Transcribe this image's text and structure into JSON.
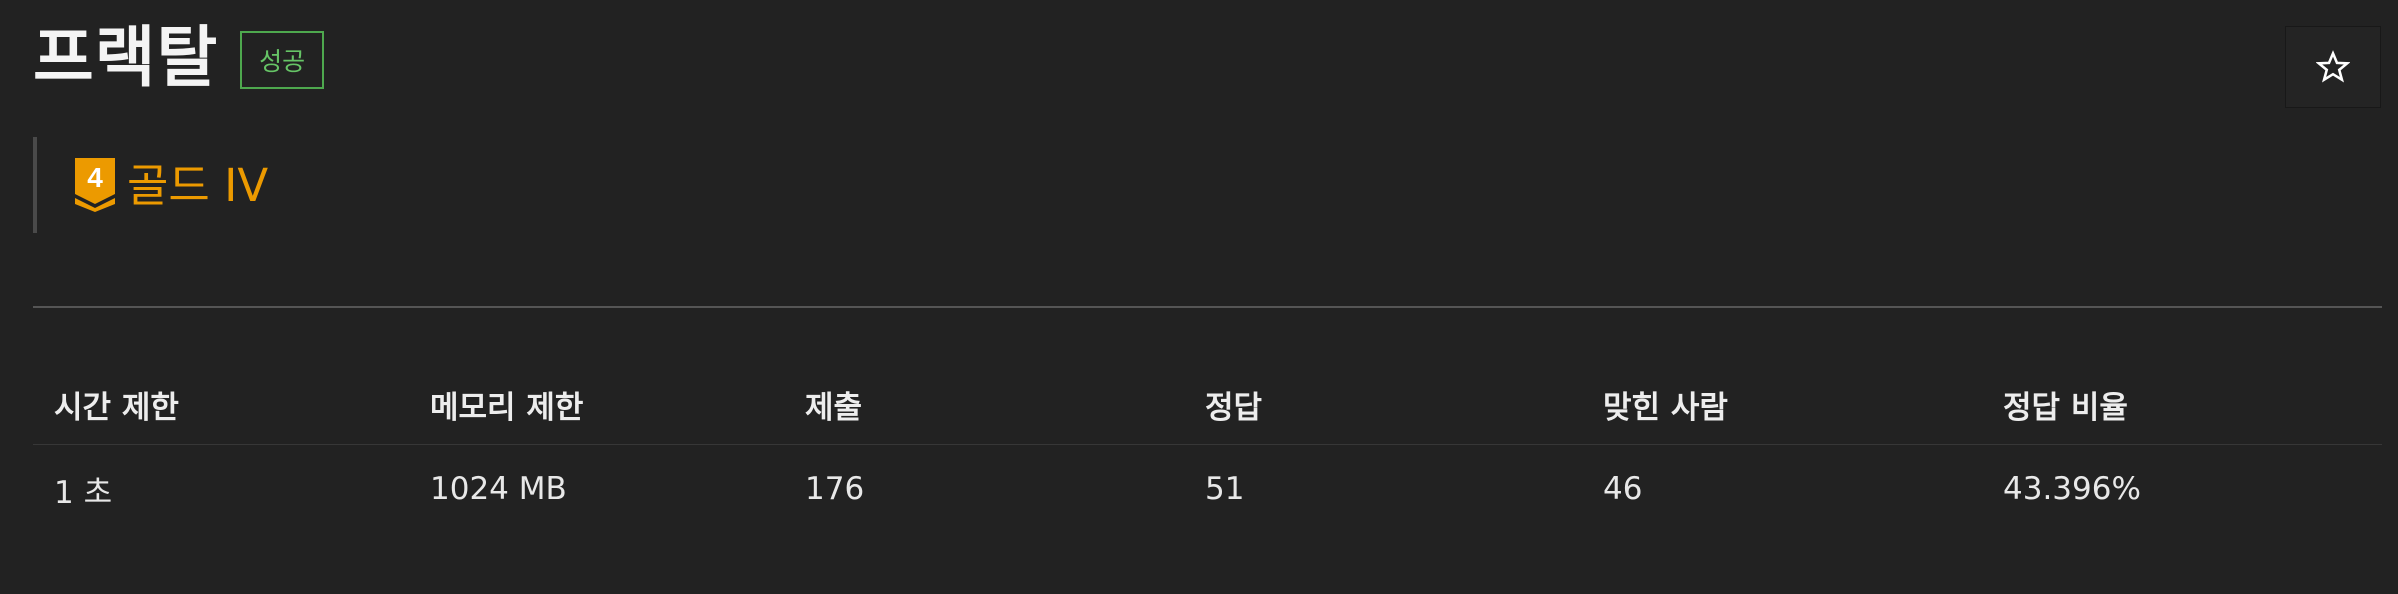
{
  "problem": {
    "title": "프랙탈",
    "result_badge": "성공"
  },
  "star": {
    "icon": "star-outline-icon",
    "color": "#ffffff"
  },
  "tier": {
    "level_number": "4",
    "name": "골드 IV",
    "color": "#ec9a00",
    "icon": "gold-tier-icon"
  },
  "stats": {
    "headers": [
      "시간 제한",
      "메모리 제한",
      "제출",
      "정답",
      "맞힌 사람",
      "정답 비율"
    ],
    "values": [
      "1 초",
      "1024 MB",
      "176",
      "51",
      "46",
      "43.396%"
    ]
  },
  "colors": {
    "background": "#222222",
    "success": "#66c466",
    "gold": "#ec9a00"
  }
}
